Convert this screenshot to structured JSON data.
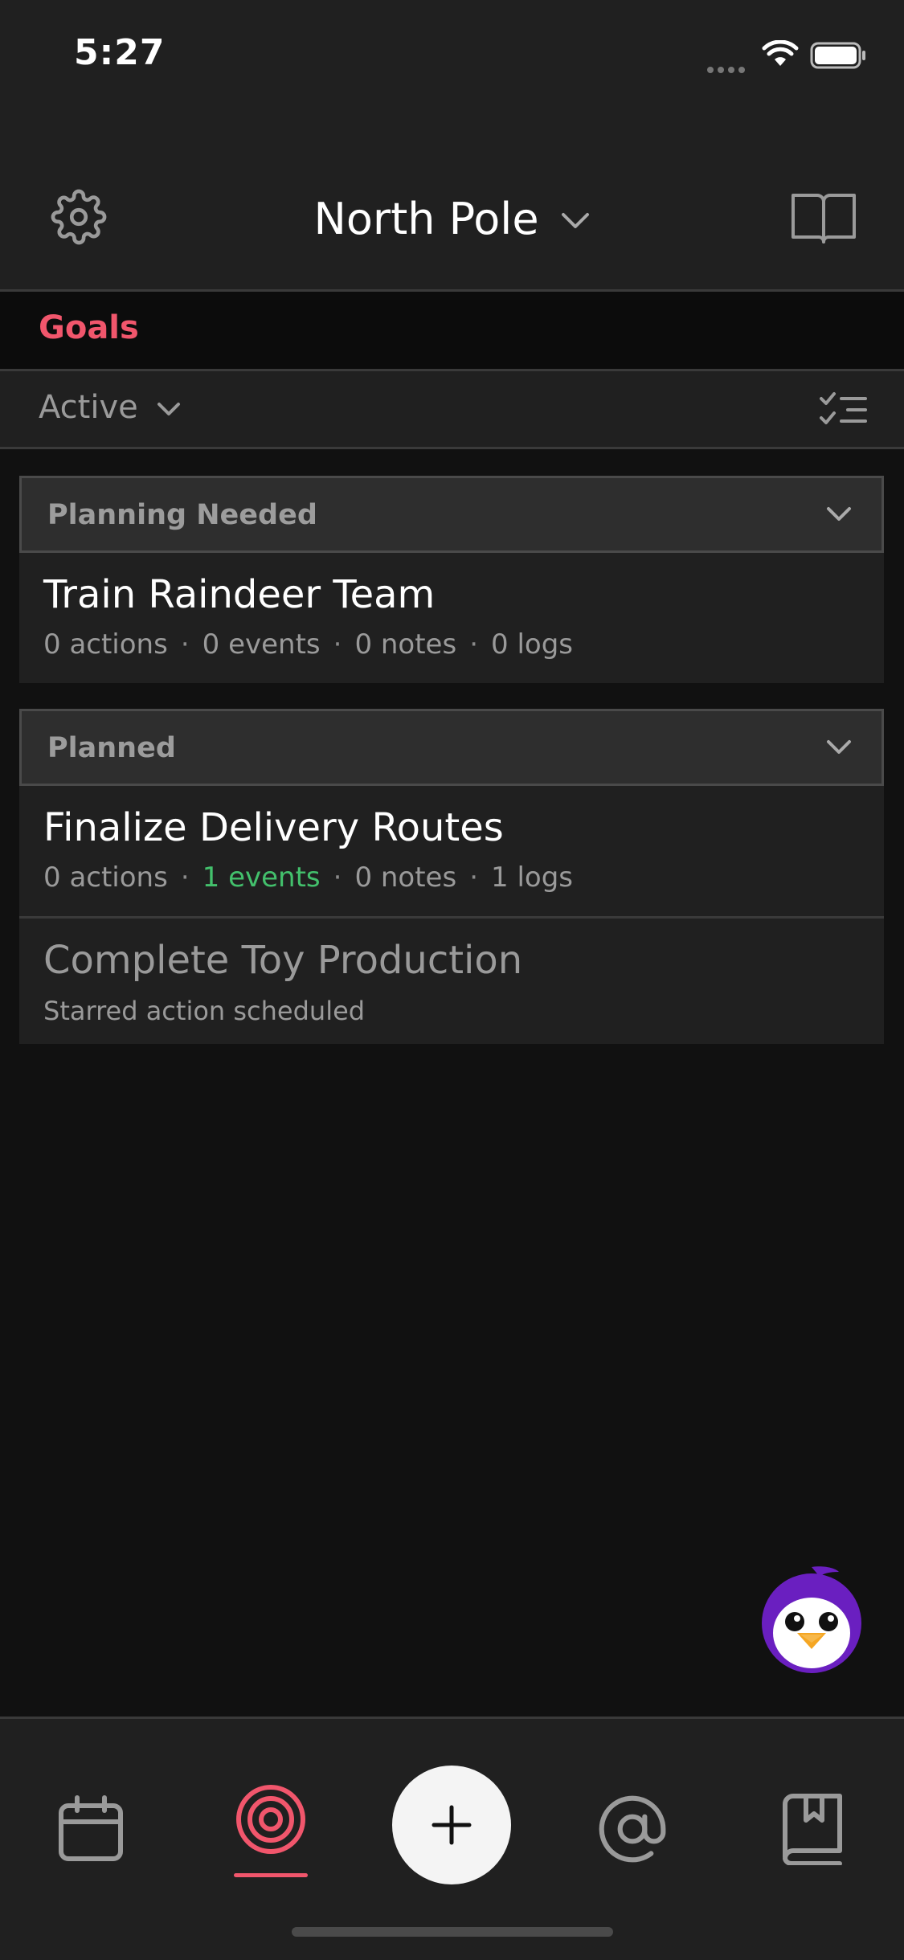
{
  "status_bar": {
    "time": "5:27"
  },
  "header": {
    "workspace": "North Pole"
  },
  "section": {
    "title": "Goals"
  },
  "filter": {
    "selected": "Active"
  },
  "groups": [
    {
      "title": "Planning Needed",
      "goals": [
        {
          "title": "Train Raindeer Team",
          "stats": [
            "0 actions",
            "0 events",
            "0 notes",
            "0 logs"
          ]
        }
      ]
    },
    {
      "title": "Planned",
      "goals": [
        {
          "title": "Finalize Delivery Routes",
          "stats": [
            "0 actions",
            "1 events",
            "0 notes",
            "1 logs"
          ]
        },
        {
          "title": "Complete Toy Production",
          "subtitle": "Starred action scheduled"
        }
      ]
    }
  ],
  "meta_separator": "·",
  "colors": {
    "accent": "#f1566c",
    "success": "#43c06c",
    "background": "#111111",
    "surface": "#202020",
    "mascot": "#6a1fc0"
  },
  "icons": {
    "settings": "gear-icon",
    "workspace_dropdown": "chevron-down-icon",
    "guide": "open-book-icon",
    "filter_dropdown": "chevron-down-icon",
    "checklist": "checklist-icon",
    "tabs": [
      "calendar-icon",
      "target-icon",
      "plus-icon",
      "at-sign-icon",
      "bookmark-book-icon"
    ]
  },
  "tab_bar": {
    "active_tab": "goals"
  }
}
